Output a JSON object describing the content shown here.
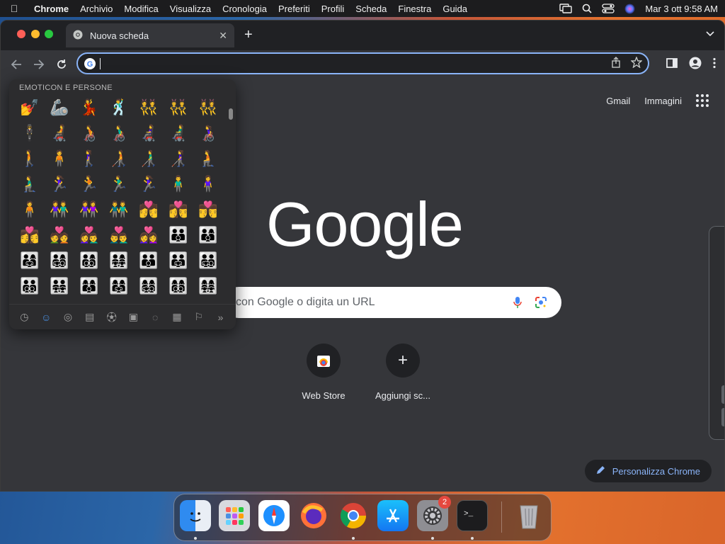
{
  "menubar": {
    "app": "Chrome",
    "items": [
      "Archivio",
      "Modifica",
      "Visualizza",
      "Cronologia",
      "Preferiti",
      "Profili",
      "Scheda",
      "Finestra",
      "Guida"
    ],
    "datetime": "Mar 3 ott  9:58 AM"
  },
  "browser": {
    "tab_title": "Nuova scheda",
    "omnibox_value": ""
  },
  "ntp": {
    "top_links": [
      "Gmail",
      "Immagini"
    ],
    "logo": "Google",
    "search_placeholder": "con Google o digita un URL",
    "shortcuts": [
      {
        "label": "Web Store"
      },
      {
        "label": "Aggiungi sc..."
      }
    ],
    "customize_label": "Personalizza Chrome"
  },
  "emoji_picker": {
    "category_title": "EMOTICON E PERSONE",
    "emojis": [
      "💅",
      "🦾",
      "💃",
      "🕺",
      "👯",
      "👯‍♂️",
      "👯‍♀️",
      "🕴",
      "🧑‍🦼",
      "🧑‍🦽",
      "👨‍🦽",
      "👩‍🦼",
      "👨‍🦼",
      "👩‍🦽",
      "🚶",
      "🧍",
      "🚶‍♀️",
      "🧑‍🦯",
      "👨‍🦯",
      "👩‍🦯",
      "🧎",
      "🧎‍♂️",
      "🏃‍♀️",
      "🏃",
      "🏃‍♂️",
      "🏃‍♀️",
      "🧍‍♂️",
      "🧍‍♀️",
      "🧍",
      "👫",
      "👭",
      "👬",
      "💏",
      "👩‍❤️‍💋‍👨",
      "👨‍❤️‍💋‍👨",
      "👩‍❤️‍💋‍👩",
      "💑",
      "👩‍❤️‍👨",
      "👨‍❤️‍👨",
      "👩‍❤️‍👩",
      "👪",
      "👨‍👩‍👦",
      "👨‍👩‍👧",
      "👨‍👩‍👧‍👦",
      "👨‍👩‍👦‍👦",
      "👨‍👩‍👧‍👧",
      "👨‍👨‍👦",
      "👨‍👨‍👧",
      "👨‍👨‍👧‍👦",
      "👨‍👨‍👦‍👦",
      "👨‍👨‍👧‍👧",
      "👩‍👩‍👦",
      "👩‍👩‍👧",
      "👩‍👩‍👧‍👦",
      "👩‍👩‍👦‍👦",
      "👩‍👩‍👧‍👧"
    ],
    "categories": [
      "clock-icon",
      "smiley-icon",
      "animal-icon",
      "food-icon",
      "ball-icon",
      "car-icon",
      "bulb-icon",
      "symbols-icon",
      "flag-icon",
      "more-icon"
    ]
  },
  "dock": {
    "apps": [
      "Finder",
      "Launchpad",
      "Safari",
      "Firefox",
      "Chrome",
      "App Store",
      "Impostazioni di Sistema",
      "Terminale",
      "Cestino"
    ],
    "settings_badge": "2"
  },
  "colors": {
    "accent": "#8ab4f8",
    "ntp_bg": "#35363a",
    "toolbar": "#35363a",
    "window": "#202124"
  }
}
